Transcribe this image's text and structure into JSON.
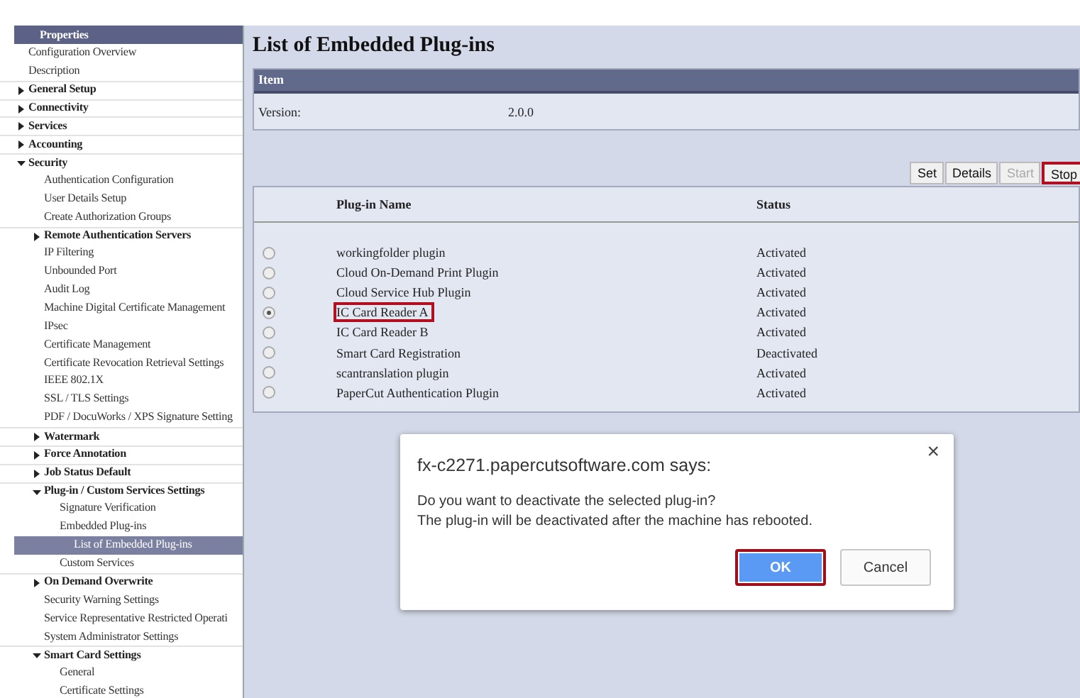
{
  "sidebar": {
    "title": "Properties",
    "items": [
      {
        "label": "Configuration Overview",
        "kind": "link",
        "selected": false
      },
      {
        "label": "Description",
        "kind": "link",
        "selected": false
      },
      {
        "label": "General Setup",
        "kind": "group",
        "expanded": false,
        "selected": false
      },
      {
        "label": "Connectivity",
        "kind": "group",
        "expanded": false,
        "selected": false
      },
      {
        "label": "Services",
        "kind": "group",
        "expanded": false,
        "selected": false
      },
      {
        "label": "Accounting",
        "kind": "group",
        "expanded": false,
        "selected": false
      },
      {
        "label": "Security",
        "kind": "group",
        "expanded": true,
        "selected": false,
        "children": [
          {
            "label": "Authentication Configuration",
            "kind": "link",
            "selected": false
          },
          {
            "label": "User Details Setup",
            "kind": "link",
            "selected": false
          },
          {
            "label": "Create Authorization Groups",
            "kind": "link",
            "selected": false
          },
          {
            "label": "Remote Authentication Servers",
            "kind": "group",
            "expanded": false,
            "selected": false
          },
          {
            "label": "IP Filtering",
            "kind": "link",
            "selected": false
          },
          {
            "label": "Unbounded Port",
            "kind": "link",
            "selected": false
          },
          {
            "label": "Audit Log",
            "kind": "link",
            "selected": false
          },
          {
            "label": "Machine Digital Certificate Management",
            "kind": "link",
            "selected": false
          },
          {
            "label": "IPsec",
            "kind": "link",
            "selected": false
          },
          {
            "label": "Certificate Management",
            "kind": "link",
            "selected": false
          },
          {
            "label": "Certificate Revocation Retrieval Settings",
            "kind": "link",
            "selected": false
          },
          {
            "label": "IEEE 802.1X",
            "kind": "link",
            "selected": false
          },
          {
            "label": "SSL / TLS Settings",
            "kind": "link",
            "selected": false
          },
          {
            "label": "PDF / DocuWorks / XPS Signature Setting",
            "kind": "link",
            "selected": false
          },
          {
            "label": "Watermark",
            "kind": "group",
            "expanded": false,
            "selected": false
          },
          {
            "label": "Force Annotation",
            "kind": "group",
            "expanded": false,
            "selected": false
          },
          {
            "label": "Job Status Default",
            "kind": "group",
            "expanded": false,
            "selected": false
          },
          {
            "label": "Plug-in / Custom Services Settings",
            "kind": "group",
            "expanded": true,
            "selected": false,
            "children": [
              {
                "label": "Signature Verification",
                "kind": "link",
                "selected": false
              },
              {
                "label": "Embedded Plug-ins",
                "kind": "link",
                "selected": false
              },
              {
                "label": "List of Embedded Plug-ins",
                "kind": "link",
                "selected": true
              },
              {
                "label": "Custom Services",
                "kind": "link",
                "selected": false
              }
            ]
          },
          {
            "label": "On Demand Overwrite",
            "kind": "group",
            "expanded": false,
            "selected": false
          },
          {
            "label": "Security Warning Settings",
            "kind": "link",
            "selected": false
          },
          {
            "label": "Service Representative Restricted Operati",
            "kind": "link",
            "selected": false
          },
          {
            "label": "System Administrator Settings",
            "kind": "link",
            "selected": false
          },
          {
            "label": "Smart Card Settings",
            "kind": "group",
            "expanded": true,
            "selected": false,
            "children": [
              {
                "label": "General",
                "kind": "link",
                "selected": false
              },
              {
                "label": "Certificate Settings",
                "kind": "link",
                "selected": false
              }
            ]
          }
        ]
      }
    ]
  },
  "page": {
    "title": "List of Embedded Plug-ins",
    "item_panel": {
      "header": "Item",
      "label": "Version:",
      "value": "2.0.0"
    },
    "buttons": [
      {
        "label": "Set",
        "disabled": false,
        "highlighted": false
      },
      {
        "label": "Details",
        "disabled": false,
        "highlighted": false
      },
      {
        "label": "Start",
        "disabled": true,
        "highlighted": false
      },
      {
        "label": "Stop",
        "disabled": false,
        "highlighted": true
      }
    ],
    "table": {
      "columns": [
        "Plug-in Name",
        "Status"
      ],
      "rows": [
        {
          "name": "workingfolder plugin",
          "status": "Activated",
          "selected": false,
          "highlighted": false
        },
        {
          "name": "Cloud On-Demand Print Plugin",
          "status": "Activated",
          "selected": false,
          "highlighted": false
        },
        {
          "name": "Cloud Service Hub Plugin",
          "status": "Activated",
          "selected": false,
          "highlighted": false
        },
        {
          "name": "IC Card Reader A",
          "status": "Activated",
          "selected": true,
          "highlighted": true
        },
        {
          "name": "IC Card Reader B",
          "status": "Activated",
          "selected": false,
          "highlighted": false
        },
        {
          "name": "Smart Card Registration",
          "status": "Deactivated",
          "selected": false,
          "highlighted": false
        },
        {
          "name": "scantranslation plugin",
          "status": "Activated",
          "selected": false,
          "highlighted": false
        },
        {
          "name": "PaperCut Authentication Plugin",
          "status": "Activated",
          "selected": false,
          "highlighted": false
        }
      ]
    }
  },
  "dialog": {
    "title": "fx-c2271.papercutsoftware.com says:",
    "close": "×",
    "message": [
      "Do you want to deactivate the selected plug-in?",
      "The plug-in will be deactivated after the machine has rebooted."
    ],
    "buttons": [
      {
        "label": "OK",
        "primary": true,
        "highlighted": true
      },
      {
        "label": "Cancel",
        "primary": false,
        "highlighted": false
      }
    ]
  }
}
